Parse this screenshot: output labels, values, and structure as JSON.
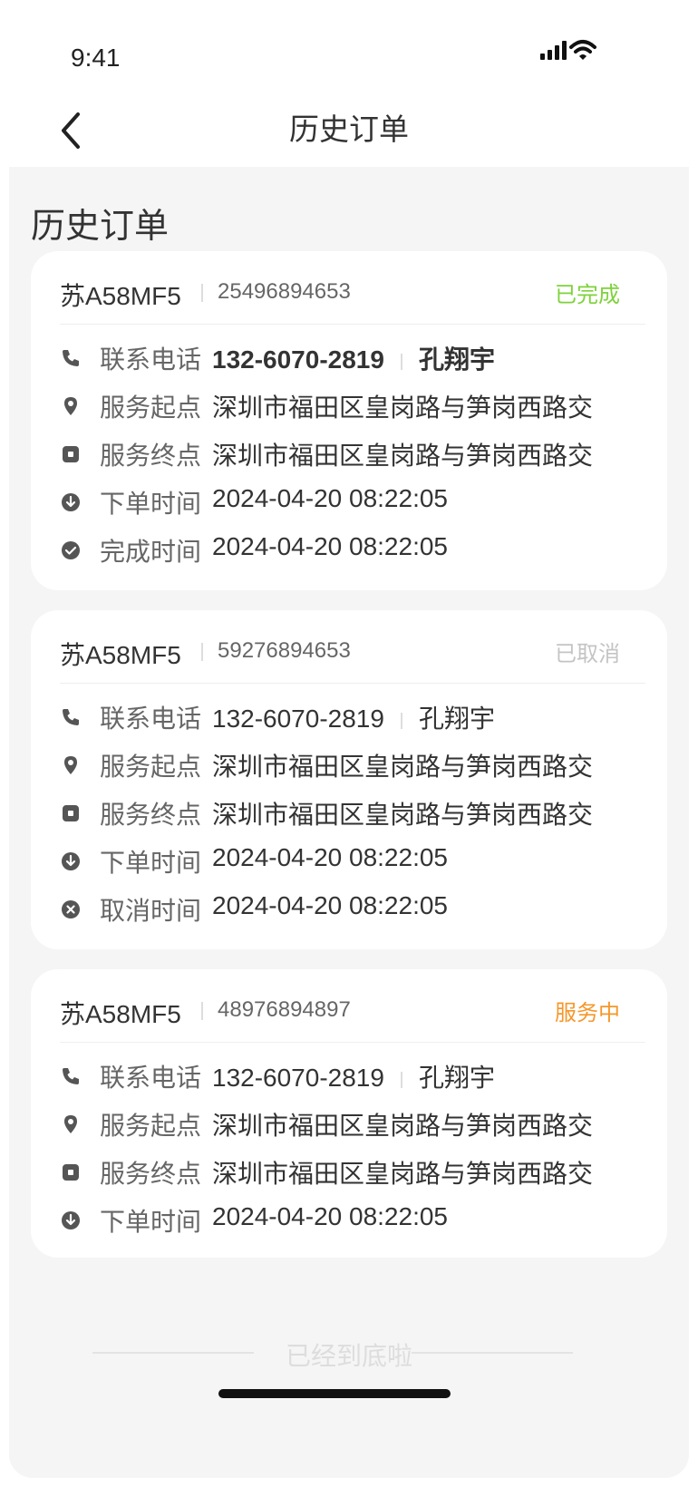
{
  "status_bar": {
    "time": "9:41"
  },
  "nav": {
    "title": "历史订单"
  },
  "page": {
    "heading": "历史订单",
    "end_text": "已经到底啦"
  },
  "labels": {
    "phone": "联系电话",
    "start": "服务起点",
    "end": "服务终点",
    "order_time": "下单时间",
    "complete_time": "完成时间",
    "cancel_time": "取消时间"
  },
  "colors": {
    "completed": "#7ed23b",
    "cancelled": "#c4c4c4",
    "in_service": "#f5972a"
  },
  "orders": [
    {
      "plate": "苏A58MF5",
      "order_no": "25496894653",
      "status": "已完成",
      "phone": "132-6070-2819",
      "contact": "孔翔宇",
      "start": "深圳市福田区皇岗路与笋岗西路交",
      "end": "深圳市福田区皇岗路与笋岗西路交",
      "order_time": "2024-04-20 08:22:05",
      "complete_time": "2024-04-20 08:22:05"
    },
    {
      "plate": "苏A58MF5",
      "order_no": "59276894653",
      "status": "已取消",
      "phone": "132-6070-2819",
      "contact": "孔翔宇",
      "start": "深圳市福田区皇岗路与笋岗西路交",
      "end": "深圳市福田区皇岗路与笋岗西路交",
      "order_time": "2024-04-20 08:22:05",
      "cancel_time": "2024-04-20 08:22:05"
    },
    {
      "plate": "苏A58MF5",
      "order_no": "48976894897",
      "status": "服务中",
      "phone": "132-6070-2819",
      "contact": "孔翔宇",
      "start": "深圳市福田区皇岗路与笋岗西路交",
      "end": "深圳市福田区皇岗路与笋岗西路交",
      "order_time": "2024-04-20 08:22:05"
    }
  ]
}
